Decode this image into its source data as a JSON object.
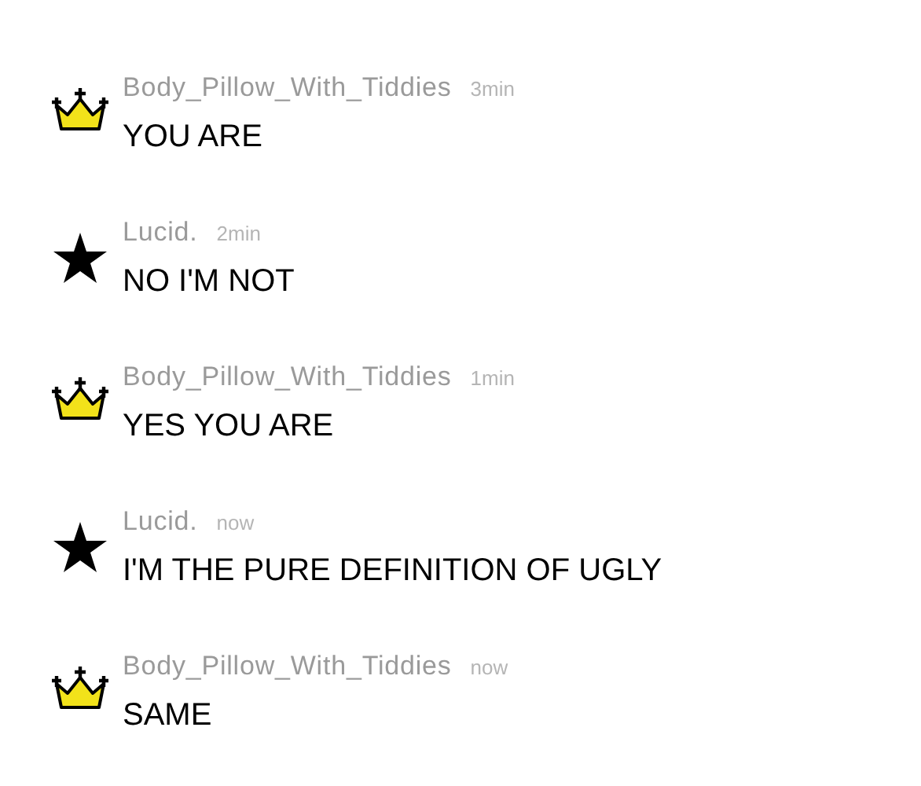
{
  "messages": [
    {
      "kind": "crown",
      "author": "Body_Pillow_With_Tiddies",
      "time": "3min",
      "text": "YOU ARE"
    },
    {
      "kind": "star",
      "author": "Lucid.",
      "time": "2min",
      "text": "NO I'M NOT"
    },
    {
      "kind": "crown",
      "author": "Body_Pillow_With_Tiddies",
      "time": "1min",
      "text": "YES YOU ARE"
    },
    {
      "kind": "star",
      "author": "Lucid.",
      "time": "now",
      "text": "I'M THE PURE DEFINITION OF UGLY"
    },
    {
      "kind": "crown",
      "author": "Body_Pillow_With_Tiddies",
      "time": "now",
      "text": "SAME"
    }
  ]
}
